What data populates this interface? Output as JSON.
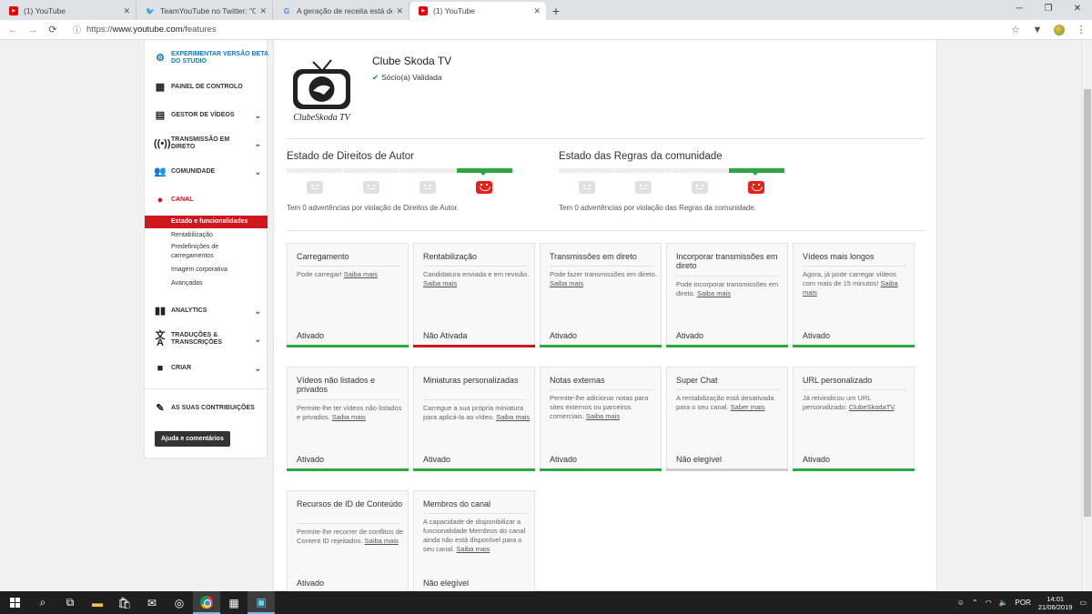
{
  "browser": {
    "tabs": [
      {
        "title": "(1) YouTube",
        "icon": "youtube-icon",
        "active": false
      },
      {
        "title": "TeamYouTube no Twitter: \"Olá, c",
        "icon": "twitter-icon",
        "active": false
      },
      {
        "title": "A geração de receita está desati",
        "icon": "google-icon",
        "active": false
      },
      {
        "title": "(1) YouTube",
        "icon": "youtube-icon",
        "active": true
      }
    ],
    "url_scheme": "https://",
    "url_domain": "www.youtube.com",
    "url_path": "/features"
  },
  "sidebar": {
    "studio_beta": "EXPERIMENTAR VERSÃO BETA DO STUDIO",
    "items": [
      {
        "label": "PAINEL DE CONTROLO",
        "icon": "dashboard-icon"
      },
      {
        "label": "GESTOR DE VÍDEOS",
        "icon": "video-manager-icon"
      },
      {
        "label": "TRANSMISSÃO EM DIRETO",
        "icon": "live-icon"
      },
      {
        "label": "COMUNIDADE",
        "icon": "community-icon"
      },
      {
        "label": "CANAL",
        "icon": "channel-icon"
      },
      {
        "label": "ANALYTICS",
        "icon": "analytics-icon"
      },
      {
        "label": "TRADUÇÕES & TRANSCRIÇÕES",
        "icon": "translate-icon"
      },
      {
        "label": "CRIAR",
        "icon": "create-icon"
      },
      {
        "label": "AS SUAS CONTRIBUIÇÕES",
        "icon": "contributions-icon"
      }
    ],
    "channel_sub": [
      "Estado e funcionalidades",
      "Rentabilização",
      "Predefinições de carregamentos",
      "Imagem corporativa",
      "Avançadas"
    ],
    "help_button": "Ajuda e comentários"
  },
  "channel": {
    "logo_text": "ClubeSkoda TV",
    "name": "Clube Skoda TV",
    "partner_status": "Sócio(a) Validada"
  },
  "status": {
    "copyright_title": "Estado de Direitos de Autor",
    "copyright_text": "Tem 0 advertências por violação de Direitos de Autor.",
    "community_title": "Estado das Regras da comunidade",
    "community_text": "Tem 0 advertências por violação das Regras da comunidade."
  },
  "cards": [
    {
      "title": "Carregamento",
      "desc": "Pode carregar!",
      "link": "Saiba mais",
      "status": "Ativado",
      "state": "on"
    },
    {
      "title": "Rentabilização",
      "desc": "Candidatura enviada e em revisão.",
      "link": "Saiba mais",
      "status": "Não Ativada",
      "state": "off"
    },
    {
      "title": "Transmissões em direto",
      "desc": "Pode fazer transmissões em direto.",
      "link": "Saiba mais",
      "status": "Ativado",
      "state": "on"
    },
    {
      "title": "Incorporar transmissões em direto",
      "desc": "Pode incorporar transmissões em direto.",
      "link": "Saiba mais",
      "status": "Ativado",
      "state": "on"
    },
    {
      "title": "Vídeos mais longos",
      "desc": "Agora, já pode carregar vídeos com mais de 15 minutos!",
      "link": "Saiba mais",
      "status": "Ativado",
      "state": "on"
    },
    {
      "title": "Vídeos não listados e privados",
      "desc": "Permite-lhe ter vídeos não listados e privados.",
      "link": "Saiba mais",
      "status": "Ativado",
      "state": "on"
    },
    {
      "title": "Miniaturas personalizadas",
      "desc": "Carregue a sua própria miniatura para aplicá-la ao vídeo.",
      "link": "Saiba mais",
      "status": "Ativado",
      "state": "on"
    },
    {
      "title": "Notas externas",
      "desc": "Permite-lhe adicionar notas para sites externos ou parceiros comerciais.",
      "link": "Saiba mais",
      "status": "Ativado",
      "state": "on"
    },
    {
      "title": "Super Chat",
      "desc": "A rentabilização está desativada para o seu canal.",
      "link": "Saber mais",
      "status": "Não elegível",
      "state": "ne"
    },
    {
      "title": "URL personalizado",
      "desc": "Já reivindicou um URL personalizado:",
      "link": "ClubeSkodaTV",
      "suffix": ".",
      "status": "Ativado",
      "state": "on"
    },
    {
      "title": "Recursos de ID de Conteúdo",
      "desc": "Permite-lhe recorrer de conflitos de Content ID rejeitados.",
      "link": "Saiba mais",
      "status": "Ativado",
      "state": "on"
    },
    {
      "title": "Membros do canal",
      "desc": "A capacidade de disponibilizar a funcionalidade Membros do canal ainda não está disponível para o seu canal.",
      "link": "Saiba mais",
      "status": "Não elegível",
      "state": "ne"
    }
  ],
  "taskbar": {
    "language": "POR",
    "time": "14:01",
    "date": "21/06/2019"
  },
  "colors": {
    "accent_red": "#cc181e",
    "accent_green": "#2ba640",
    "accent_blue": "#167ac6"
  }
}
